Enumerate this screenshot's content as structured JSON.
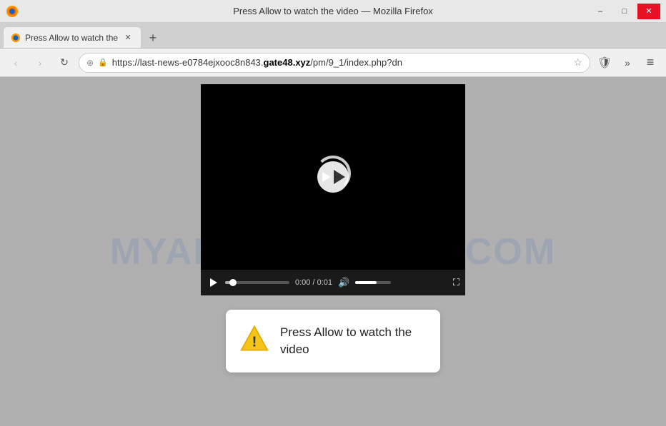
{
  "titlebar": {
    "title": "Press Allow to watch the video — Mozilla Firefox",
    "minimize_label": "–",
    "maximize_label": "□",
    "close_label": "✕"
  },
  "tab": {
    "label": "Press Allow to watch the",
    "close": "✕"
  },
  "new_tab_btn": "+",
  "navbar": {
    "back": "‹",
    "forward": "›",
    "reload": "↻",
    "url_shield": "⊕",
    "url_lock": "🔒",
    "url_text_pre": "https://last-news-e0784ejxooc8n843.",
    "url_domain": "gate48.xyz",
    "url_text_post": "/pm/9_1/index.php?dn",
    "url_star": "☆",
    "bookmarks": "📚",
    "extensions": "»",
    "menu": "≡"
  },
  "video": {
    "time": "0:00 / 0:01"
  },
  "watermark": "MYANTISPYWARE.COM",
  "notification": {
    "text": "Press Allow to watch the video"
  }
}
